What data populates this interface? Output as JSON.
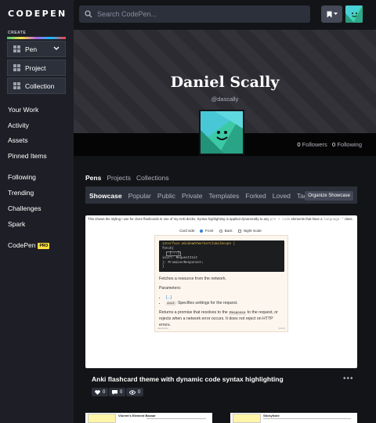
{
  "app": {
    "logo": "CODEPEN"
  },
  "sidebar": {
    "create_label": "CREATE",
    "create_buttons": [
      {
        "label": "Pen"
      },
      {
        "label": "Project"
      },
      {
        "label": "Collection"
      }
    ],
    "nav": [
      {
        "label": "Your Work"
      },
      {
        "label": "Activity"
      },
      {
        "label": "Assets"
      },
      {
        "label": "Pinned Items"
      },
      {
        "label": "Following"
      },
      {
        "label": "Trending"
      },
      {
        "label": "Challenges"
      },
      {
        "label": "Spark"
      },
      {
        "label": "CodePen"
      }
    ],
    "pro_badge": "PRO"
  },
  "search": {
    "placeholder": "Search CodePen..."
  },
  "profile": {
    "name": "Daniel Scally",
    "handle": "@dascally",
    "followers_count": "0",
    "followers_label": "Followers",
    "following_count": "0",
    "following_label": "Following"
  },
  "tabs_primary": [
    "Pens",
    "Projects",
    "Collections"
  ],
  "tabs_secondary": [
    "Showcase",
    "Popular",
    "Public",
    "Private",
    "Templates",
    "Forked",
    "Loved",
    "Tags"
  ],
  "organize_label": "Organize Showcase",
  "pen": {
    "title": "Anki flashcard theme with dynamic code syntax highlighting",
    "preview": {
      "desc_a": "This shows the styling I use for cloze flashcards in one of my Anki decks. Syntax highlighting is applied dynamically to any",
      "desc_code1": "pre > code",
      "desc_b": "elements that have a",
      "desc_code2": "language-*",
      "desc_c": "class.",
      "card_side_label": "Card side:",
      "options": [
        "Front",
        "Back",
        "Night mode"
      ],
      "code_lines": [
        "interface WindowOrWorkerGlobalScope {",
        "  fetch(",
        "    [...]",
        "    init?: RequestInit",
        "  ): Promise<Response>;",
        "}"
      ],
      "line1": "Fetches a resource from the network.",
      "params_label": "Parameters:",
      "bullet1": "[...]",
      "bullet2_code": "init",
      "bullet2_text": ": Specifies settings for the request.",
      "returns_a": "Returns a promise that resolves to the",
      "returns_code": "Response",
      "returns_b": "to the request, or rejects when a network error occurs. It does not reject on HTTP errors.",
      "footer_left": "JavaScript",
      "footer_right": "fetch()"
    },
    "likes": "0",
    "comments": "0",
    "views": "0"
  },
  "thumbs": [
    {
      "title": "Vlorem's Element Bazaar"
    },
    {
      "title": "StickyNote"
    }
  ],
  "colors": {
    "sidebar_bg": "#1e1f26",
    "page_bg": "#131417",
    "accent_yellow": "#ffdd40"
  }
}
